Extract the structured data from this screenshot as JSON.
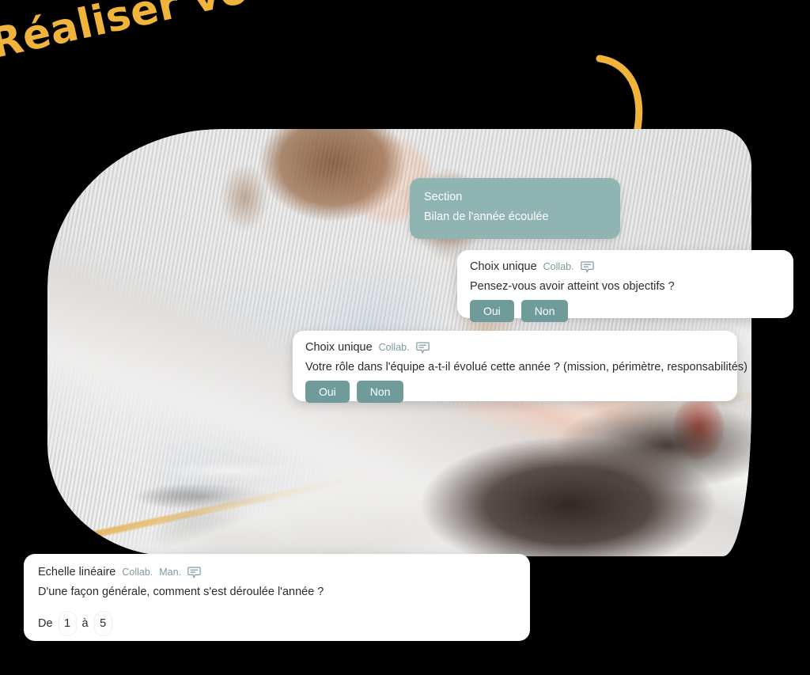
{
  "headline": {
    "text": "Réaliser vos trames d'entretiens",
    "color": "#f0b43c"
  },
  "arrow": {
    "name": "curved-down-arrow",
    "color": "#f0b43c"
  },
  "photo": {
    "alt": "Femme souriante tapant sur un ordinateur portable"
  },
  "section_card": {
    "label": "Section",
    "title": "Bilan de l'année écoulée",
    "bg": "#8fb4b2"
  },
  "questions": [
    {
      "type": "Choix unique",
      "tags": [
        "Collab."
      ],
      "icon": "comment-icon",
      "text": "Pensez-vous avoir atteint vos objectifs ?",
      "choices": [
        "Oui",
        "Non"
      ]
    },
    {
      "type": "Choix unique",
      "tags": [
        "Collab."
      ],
      "icon": "comment-icon",
      "text": "Votre rôle dans l'équipe a-t-il évolué cette année ? (mission, périmètre, responsabilités)",
      "choices": [
        "Oui",
        "Non"
      ]
    },
    {
      "type": "Echelle linéaire",
      "tags": [
        "Collab.",
        "Man."
      ],
      "icon": "comment-icon",
      "text": "D'une façon générale, comment s'est déroulée l'année ?",
      "scale": {
        "prefix": "De",
        "min": "1",
        "middle": "à",
        "max": "5"
      }
    }
  ],
  "colors": {
    "accent_teal": "#6f9c9a",
    "section_teal": "#8fb4b2",
    "tag_gray": "#7b9a9b",
    "text_dark": "#2b2b33",
    "gold": "#f0b43c"
  }
}
